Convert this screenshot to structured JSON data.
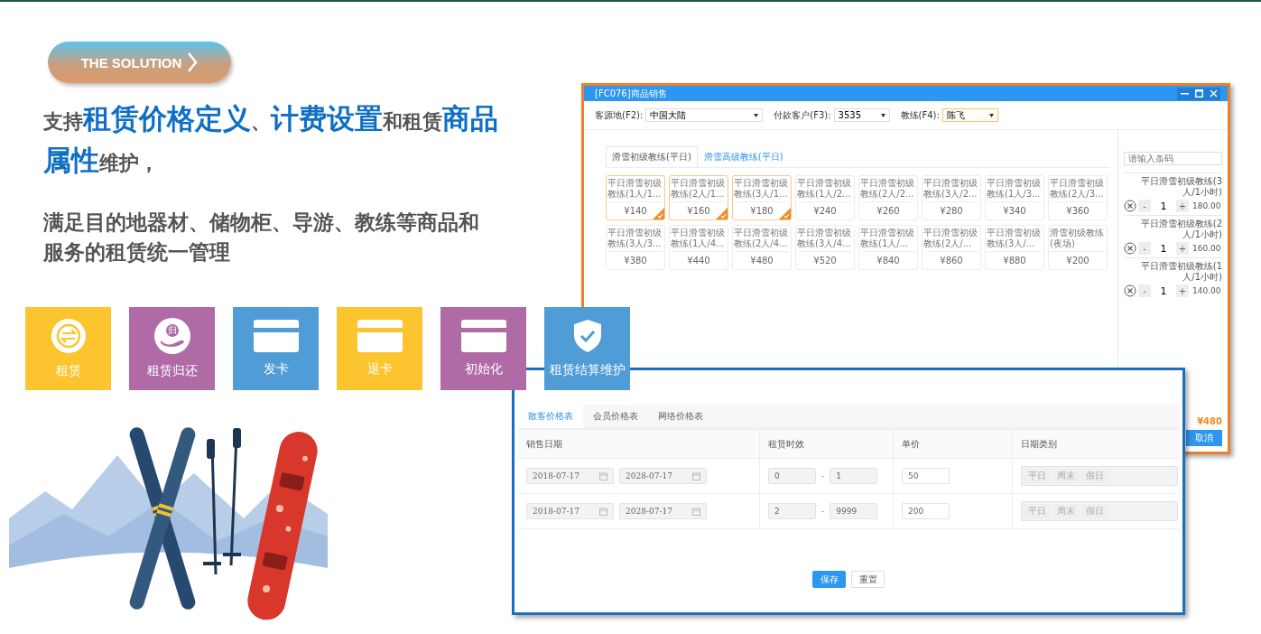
{
  "badge": {
    "label": "THE SOLUTION"
  },
  "headline": "支持**租赁价格定义**、**计费设置**和租赁**商品属性**维护，",
  "description": "满足目的地器材、储物柜、导游、教练等商品和服务的租赁统一管理",
  "tiles": [
    {
      "label": "租赁",
      "kind": "exchange",
      "color": "#fcc42e"
    },
    {
      "label": "租赁归还",
      "kind": "return",
      "color": "#b06aa6",
      "icon_text": "归"
    },
    {
      "label": "发卡",
      "kind": "card",
      "color": "#4f9cd6"
    },
    {
      "label": "退卡",
      "kind": "card",
      "color": "#fcc42e"
    },
    {
      "label": "初始化",
      "kind": "card",
      "color": "#b06aa6"
    },
    {
      "label": "租赁结算维护",
      "kind": "shield",
      "color": "#4f9cd6"
    }
  ],
  "sales_window": {
    "title": "[FC076]商品销售",
    "filters": [
      {
        "label": "客源地(F2):",
        "value": "中国大陆",
        "focused": false
      },
      {
        "label": "付款客户(F3):",
        "value": "3535",
        "focused": false
      },
      {
        "label": "教练(F4):",
        "value": "陈飞",
        "focused": true
      }
    ],
    "tabs": [
      {
        "label": "滑雪初级教练(平日)",
        "selected": true
      },
      {
        "label": "滑雪高级教练(平日)",
        "selected": false
      }
    ],
    "products": [
      {
        "name": "平日滑雪初级教练(1人/1...",
        "price": "¥140",
        "selected": true
      },
      {
        "name": "平日滑雪初级教练(2人/1...",
        "price": "¥160",
        "selected": true
      },
      {
        "name": "平日滑雪初级教练(3人/1...",
        "price": "¥180",
        "selected": true
      },
      {
        "name": "平日滑雪初级教练(1人/2...",
        "price": "¥240",
        "selected": false
      },
      {
        "name": "平日滑雪初级教练(2人/2...",
        "price": "¥260",
        "selected": false
      },
      {
        "name": "平日滑雪初级教练(3人/2...",
        "price": "¥280",
        "selected": false
      },
      {
        "name": "平日滑雪初级教练(1人/3...",
        "price": "¥340",
        "selected": false
      },
      {
        "name": "平日滑雪初级教练(2人/3...",
        "price": "¥360",
        "selected": false
      },
      {
        "name": "平日滑雪初级教练(3人/3...",
        "price": "¥380",
        "selected": false
      },
      {
        "name": "平日滑雪初级教练(1人/4...",
        "price": "¥440",
        "selected": false
      },
      {
        "name": "平日滑雪初级教练(2人/4...",
        "price": "¥480",
        "selected": false
      },
      {
        "name": "平日滑雪初级教练(3人/4...",
        "price": "¥520",
        "selected": false
      },
      {
        "name": "平日滑雪初级教练(1人/...",
        "price": "¥840",
        "selected": false
      },
      {
        "name": "平日滑雪初级教练(2人/...",
        "price": "¥860",
        "selected": false
      },
      {
        "name": "平日滑雪初级教练(3人/...",
        "price": "¥880",
        "selected": false
      },
      {
        "name": "滑雪初级教练(夜场)",
        "price": "¥200",
        "selected": false
      }
    ],
    "barcode": {
      "placeholder": "请输入条码"
    },
    "cart": [
      {
        "name": "平日滑雪初级教练(3人/1小时)",
        "minus": "-",
        "quantity": "1",
        "plus": "+",
        "amount": "180.00"
      },
      {
        "name": "平日滑雪初级教练(2人/1小时)",
        "minus": "-",
        "quantity": "1",
        "plus": "+",
        "amount": "160.00"
      },
      {
        "name": "平日滑雪初级教练(1人/1小时)",
        "minus": "-",
        "quantity": "1",
        "plus": "+",
        "amount": "140.00"
      }
    ],
    "total": "¥480",
    "cancel": "取消"
  },
  "price_window": {
    "tabs": [
      {
        "label": "散客价格表",
        "selected": true
      },
      {
        "label": "会员价格表",
        "selected": false
      },
      {
        "label": "网络价格表",
        "selected": false
      }
    ],
    "columns": [
      "销售日期",
      "租赁时效",
      "单价",
      "日期类别"
    ],
    "rows": [
      {
        "start_date": "2018-07-17",
        "end_date": "2028-07-17",
        "from": "0",
        "separator": "-",
        "to": "1",
        "price": "50",
        "day_types": [
          "平日",
          "周末",
          "假日"
        ],
        "locked": true
      },
      {
        "start_date": "2018-07-17",
        "end_date": "2028-07-17",
        "from": "2",
        "separator": "-",
        "to": "9999",
        "price": "200",
        "day_types": [
          "平日",
          "周末",
          "假日"
        ],
        "locked": true
      }
    ],
    "buttons": [
      {
        "label": "保存",
        "primary": true
      },
      {
        "label": "重置",
        "primary": false
      }
    ]
  }
}
